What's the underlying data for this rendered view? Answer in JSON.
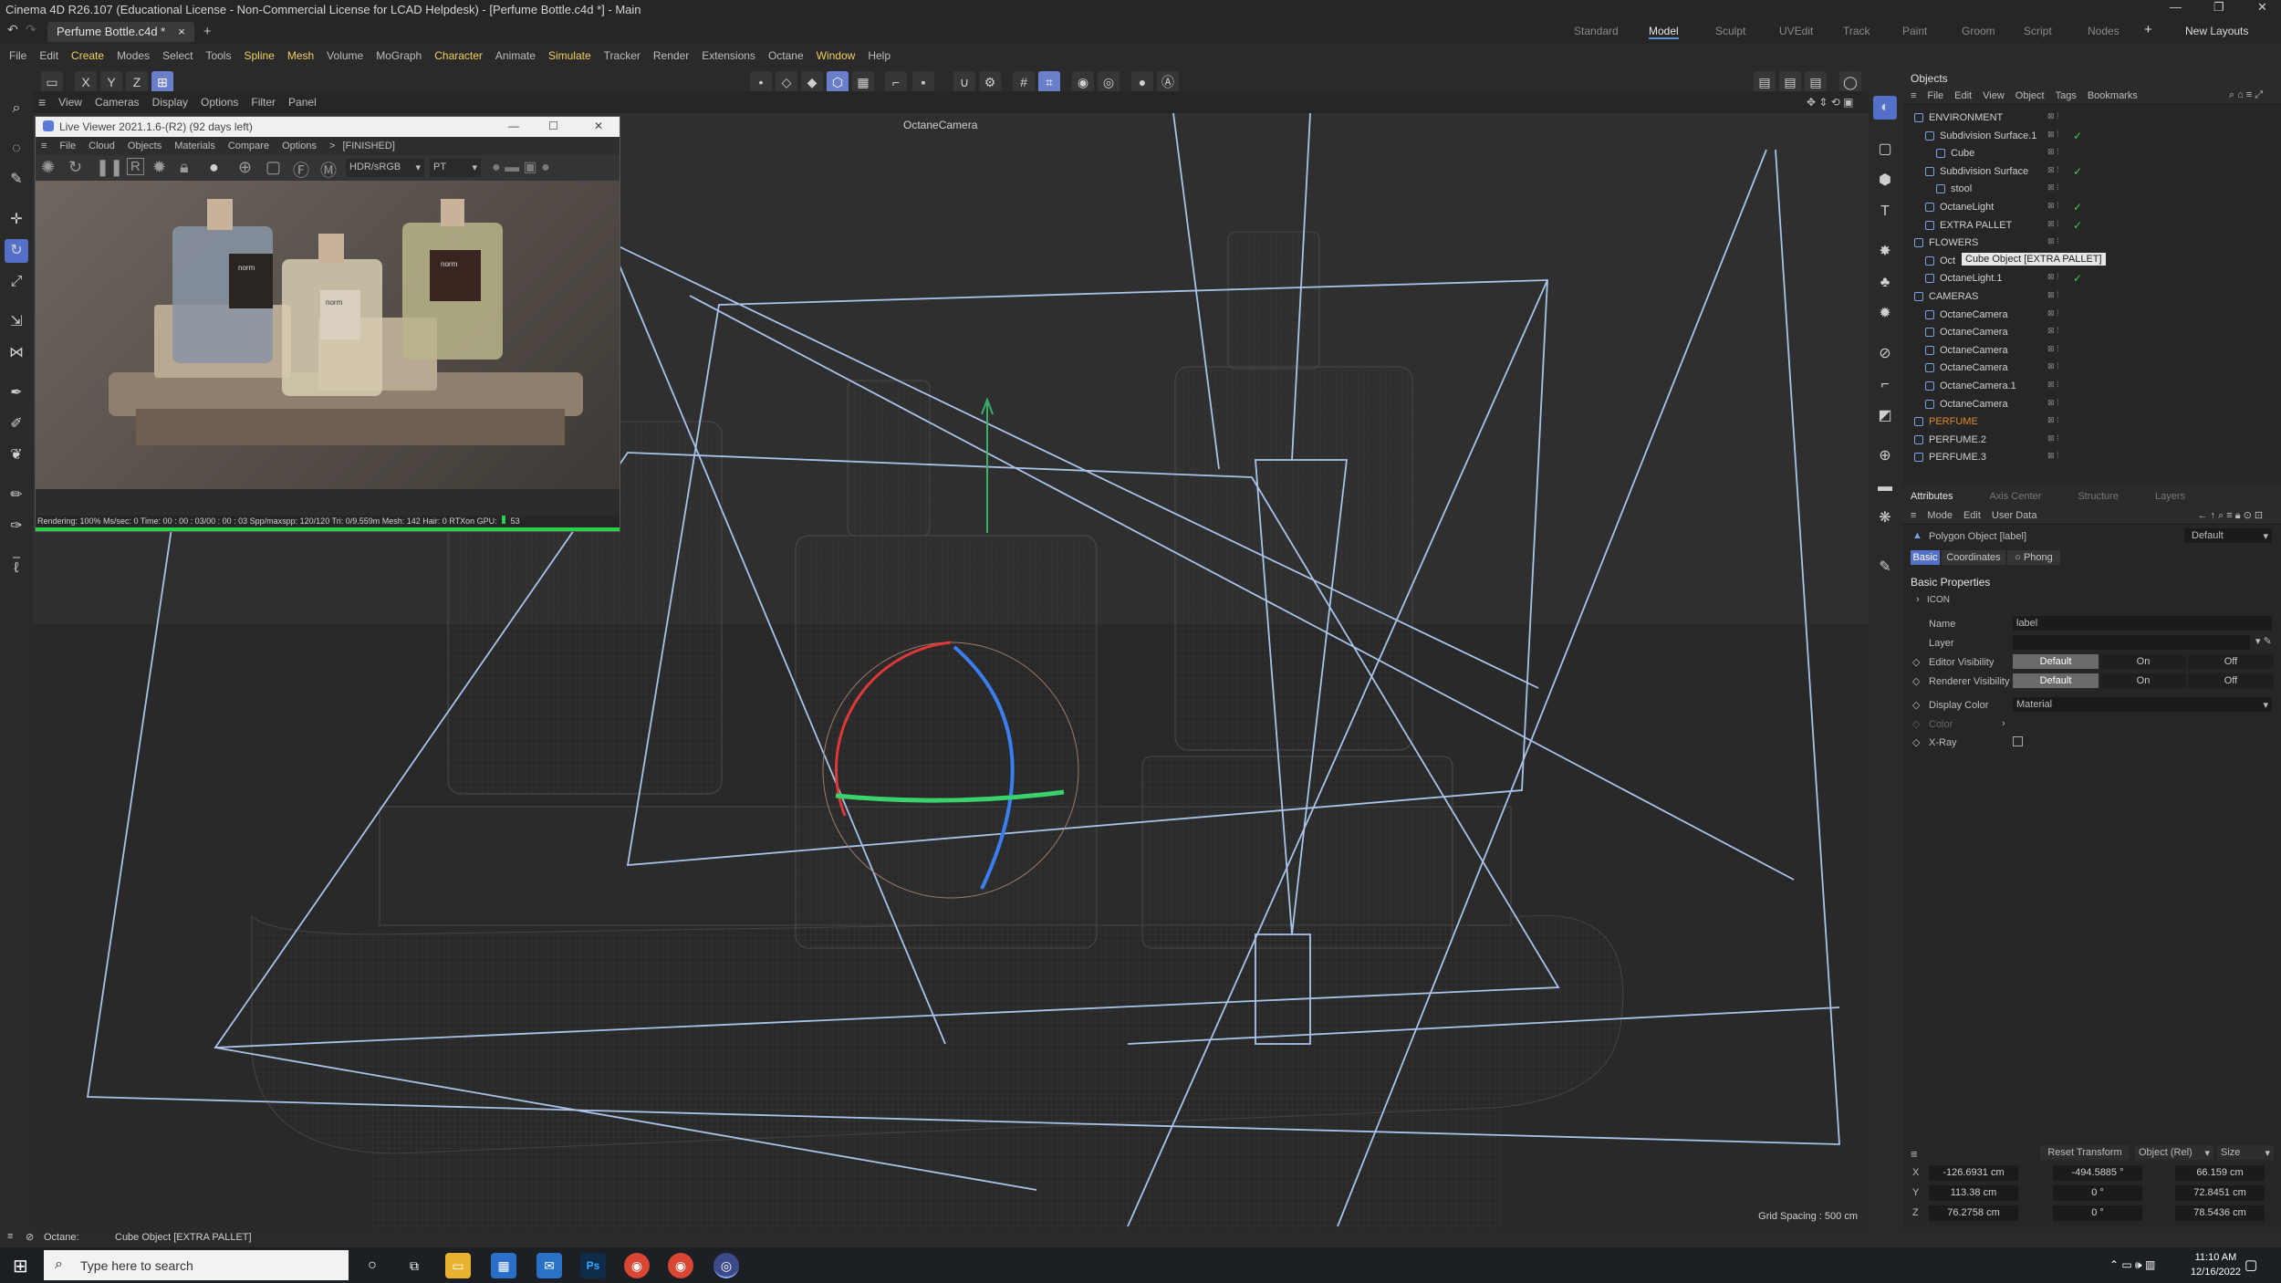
{
  "window": {
    "title": "Cinema 4D R26.107 (Educational License - Non-Commercial License for LCAD Helpdesk) - [Perfume Bottle.c4d *] - Main"
  },
  "tabs": {
    "doc_tab": "Perfume Bottle.c4d *",
    "close": "×",
    "add": "+"
  },
  "layouts": {
    "items": [
      "Standard",
      "Model",
      "Sculpt",
      "UVEdit",
      "Track",
      "Paint",
      "Groom",
      "Script",
      "Nodes"
    ],
    "active": "Model",
    "new_layouts": "New Layouts"
  },
  "menubar": [
    "File",
    "Edit",
    "Create",
    "Modes",
    "Select",
    "Tools",
    "Spline",
    "Mesh",
    "Volume",
    "MoGraph",
    "Character",
    "Animate",
    "Simulate",
    "Tracker",
    "Render",
    "Extensions",
    "Octane",
    "Window",
    "Help"
  ],
  "toolbar": {
    "axes": [
      "X",
      "Y",
      "Z"
    ]
  },
  "viewport": {
    "menu": [
      "View",
      "Cameras",
      "Display",
      "Options",
      "Filter",
      "Panel"
    ],
    "camera": "OctaneCamera",
    "grid_spacing": "Grid Spacing : 500 cm"
  },
  "live_viewer": {
    "title": "Live Viewer 2021.1.6-(R2) (92 days left)",
    "menu": [
      "File",
      "Cloud",
      "Objects",
      "Materials",
      "Compare",
      "Options"
    ],
    "crumb": ">",
    "status_tag": "[FINISHED]",
    "tonemap": "HDR/sRGB",
    "kernel": "PT",
    "status": "Rendering: 100%  Ms/sec: 0    Time: 00 : 00 : 03/00 : 00 : 03    Spp/maxspp: 120/120    Tri: 0/9.559m    Mesh: 142    Hair: 0    RTXon    GPU:",
    "gpu_value": "53",
    "progress": 1.0
  },
  "objects": {
    "title": "Objects",
    "menu": [
      "File",
      "Edit",
      "View",
      "Object",
      "Tags",
      "Bookmarks"
    ],
    "rows": [
      {
        "label": "ENVIRONMENT",
        "color": "#d0d0d0",
        "indent": 0,
        "check": ""
      },
      {
        "label": "Subdivision Surface.1",
        "color": "#d0d0d0",
        "indent": 1,
        "check": "✓"
      },
      {
        "label": "Cube",
        "color": "#d0d0d0",
        "indent": 2,
        "check": ""
      },
      {
        "label": "Subdivision Surface",
        "color": "#d0d0d0",
        "indent": 1,
        "check": "✓"
      },
      {
        "label": "stool",
        "color": "#d0d0d0",
        "indent": 2,
        "check": ""
      },
      {
        "label": "OctaneLight",
        "color": "#d0d0d0",
        "indent": 1,
        "check": "✓"
      },
      {
        "label": "EXTRA PALLET",
        "color": "#d0d0d0",
        "indent": 1,
        "check": "✓"
      },
      {
        "label": "FLOWERS",
        "color": "#d0d0d0",
        "indent": 0,
        "check": ""
      },
      {
        "label": "Oct",
        "color": "#d0d0d0",
        "indent": 1,
        "check": ""
      },
      {
        "label": "OctaneLight.1",
        "color": "#d0d0d0",
        "indent": 1,
        "check": "✓"
      },
      {
        "label": "CAMERAS",
        "color": "#d0d0d0",
        "indent": 0,
        "check": ""
      },
      {
        "label": "OctaneCamera",
        "color": "#d0d0d0",
        "indent": 1,
        "check": ""
      },
      {
        "label": "OctaneCamera",
        "color": "#d0d0d0",
        "indent": 1,
        "check": ""
      },
      {
        "label": "OctaneCamera",
        "color": "#d0d0d0",
        "indent": 1,
        "check": ""
      },
      {
        "label": "OctaneCamera",
        "color": "#d0d0d0",
        "indent": 1,
        "check": ""
      },
      {
        "label": "OctaneCamera.1",
        "color": "#d0d0d0",
        "indent": 1,
        "check": ""
      },
      {
        "label": "OctaneCamera",
        "color": "#d0d0d0",
        "indent": 1,
        "check": ""
      },
      {
        "label": "PERFUME",
        "color": "#e08a2a",
        "indent": 0,
        "check": ""
      },
      {
        "label": "PERFUME.2",
        "color": "#d0d0d0",
        "indent": 0,
        "check": ""
      },
      {
        "label": "PERFUME.3",
        "color": "#d0d0d0",
        "indent": 0,
        "check": ""
      }
    ],
    "tooltip": "Cube Object [EXTRA PALLET]"
  },
  "attributes": {
    "tabs": [
      "Attributes",
      "Axis Center",
      "Structure",
      "Layers"
    ],
    "menu": [
      "Mode",
      "Edit",
      "User Data"
    ],
    "object_label": "Polygon Object [label]",
    "preset": "Default",
    "subtabs": [
      "Basic",
      "Coordinates",
      "Phong"
    ],
    "section": "Basic Properties",
    "icon_group": "ICON",
    "name_label": "Name",
    "name_value": "label",
    "layer_label": "Layer",
    "editor_vis_label": "Editor Visibility",
    "renderer_vis_label": "Renderer Visibility",
    "vis_options": [
      "Default",
      "On",
      "Off"
    ],
    "display_color_label": "Display Color",
    "display_color_value": "Material",
    "color_label": "Color",
    "xray_label": "X-Ray"
  },
  "coords": {
    "reset": "Reset Transform",
    "mode": "Object (Rel)",
    "size": "Size",
    "rows": [
      {
        "axis": "X",
        "pos": "-126.6931 cm",
        "rot": "-494.5885 °",
        "size": "66.159 cm"
      },
      {
        "axis": "Y",
        "pos": "113.38 cm",
        "rot": "0 °",
        "size": "72.8451 cm"
      },
      {
        "axis": "Z",
        "pos": "76.2758 cm",
        "rot": "0 °",
        "size": "78.5436 cm"
      }
    ]
  },
  "statusbar": {
    "left": "Octane:",
    "text": "Cube Object [EXTRA PALLET]"
  },
  "taskbar": {
    "search": "Type here to search",
    "time": "11:10 AM",
    "date": "12/16/2022"
  },
  "labels": {
    "bottle_brand": "norm"
  }
}
